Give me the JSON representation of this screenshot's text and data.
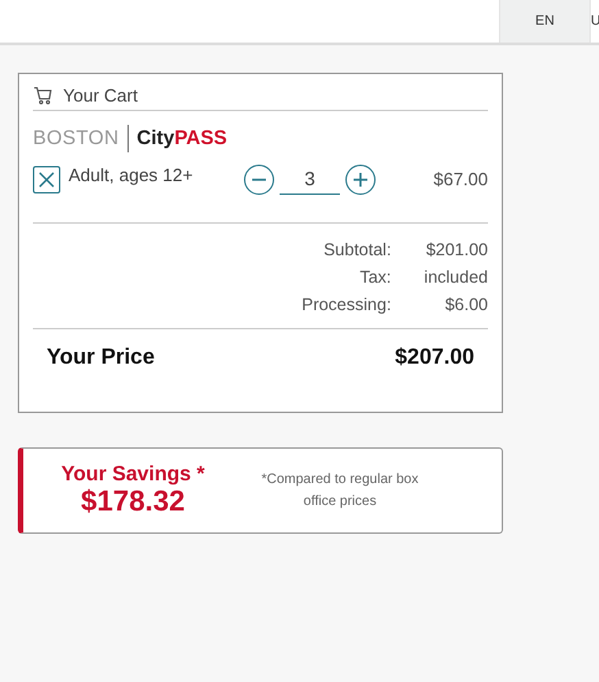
{
  "languages": [
    {
      "label": "EN"
    },
    {
      "label": "U"
    }
  ],
  "cart": {
    "title": "Your Cart",
    "logo": {
      "city": "BOSTON",
      "brand_dark": "City",
      "brand_accent": "PASS"
    },
    "items": [
      {
        "label": "Adult, ages 12+",
        "quantity": "3",
        "price": "$67.00"
      }
    ],
    "summary": [
      {
        "label": "Subtotal:",
        "value": "$201.00"
      },
      {
        "label": "Tax:",
        "value": "included"
      },
      {
        "label": "Processing:",
        "value": "$6.00"
      }
    ],
    "total": {
      "label": "Your Price",
      "value": "$207.00"
    }
  },
  "savings": {
    "title": "Your Savings *",
    "amount": "$178.32",
    "note": "*Compared to regular box office prices"
  }
}
